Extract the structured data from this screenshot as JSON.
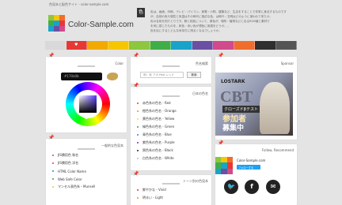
{
  "header": {
    "tagline": "色見本と配色サイト - color-sample.com",
    "logo_text": "Color-Sample.com",
    "intro_icon": "色",
    "intro_lines": [
      "色は、画面、印刷、テレビ・パソコン、家電・小物、建築など、生活をすることで非常に身近するものです",
      "が、自然の色や感性と気温はその時代に相応な色、は時代・文明はどのように使われて来たか、",
      "色の名前を知りとりです。鮮と相色について、原色が、場所・植物などに出るRGB値と素材で",
      "を何に感じたものを、和色・赤い色が想色に用語をどうか、。",
      "色を目にするとどんな気持ちに明るくなるでしょうか。"
    ]
  },
  "nav": {
    "tabs": [
      {
        "label": "",
        "color": "#d9d9d9"
      },
      {
        "label": "♥",
        "color": "#e53935"
      },
      {
        "label": "",
        "color": "#f2a900"
      },
      {
        "label": "",
        "color": "#f6c700"
      },
      {
        "label": "",
        "color": "#8dc63f"
      },
      {
        "label": "",
        "color": "#3fae49"
      },
      {
        "label": "",
        "color": "#1aa3c9"
      },
      {
        "label": "",
        "color": "#6b4fa3"
      },
      {
        "label": "",
        "color": "#d14a8b"
      },
      {
        "label": "",
        "color": "#f06d2d"
      },
      {
        "label": "",
        "color": "#2f2f2f"
      },
      {
        "label": "",
        "color": "#555555"
      }
    ]
  },
  "color_picker": {
    "title": "Color",
    "hex_value": "#170a0b"
  },
  "general_colors": {
    "title": "一般的な色見本",
    "items": [
      {
        "label": "JIS慣用色 和名",
        "bullet": "#e8336d"
      },
      {
        "label": "JIS慣用色 洋名",
        "bullet": "#e8336d"
      },
      {
        "label": "HTML Color Name",
        "bullet": "#1e88e5"
      },
      {
        "label": "Web Safe Color",
        "bullet": "#43a047"
      },
      {
        "label": "マンセル表色系・Munsell",
        "bullet": "#fbc02d"
      }
    ]
  },
  "color_search": {
    "title": "色名検索",
    "placeholder": "例：赤 アカ Red レッド",
    "button": "検索"
  },
  "japanese_colors": {
    "title": "日本の色名",
    "items": [
      {
        "label": "赤色系の色名 - Red",
        "bullet": "#e53935"
      },
      {
        "label": "橙色系の色名 - Orange",
        "bullet": "#fb8c00"
      },
      {
        "label": "黄色系の色名 - Yellow",
        "bullet": "#fdd835"
      },
      {
        "label": "緑色系の色名 - Green",
        "bullet": "#43a047"
      },
      {
        "label": "青色系の色名 - Blue",
        "bullet": "#1e88e5"
      },
      {
        "label": "紫色系の色名 - Purple",
        "bullet": "#8e24aa"
      },
      {
        "label": "黒色系の色名 - Black",
        "bullet": "#212121"
      },
      {
        "label": "白色系の色名 - White",
        "bullet": "#bdbdbd"
      }
    ]
  },
  "tone_colors": {
    "title": "トーン別の色見本",
    "items": [
      {
        "label": "鮮やかな - Vivid",
        "bullet": "#e53935"
      },
      {
        "label": "明るい - Light",
        "bullet": "#fb8c00"
      }
    ]
  },
  "sponsor": {
    "title": "Sponsor",
    "ad_brand": "LOSTARK",
    "ad_headline": "CBT",
    "ad_sub": "クローズドβテスト",
    "ad_main1": "参加者",
    "ad_main2": "募集中"
  },
  "follow": {
    "title": "Follow, Recommend",
    "name": "Color-Sample.com",
    "button": "フォローする"
  },
  "social": {
    "icons": [
      "Twitter",
      "f",
      "✉"
    ]
  }
}
